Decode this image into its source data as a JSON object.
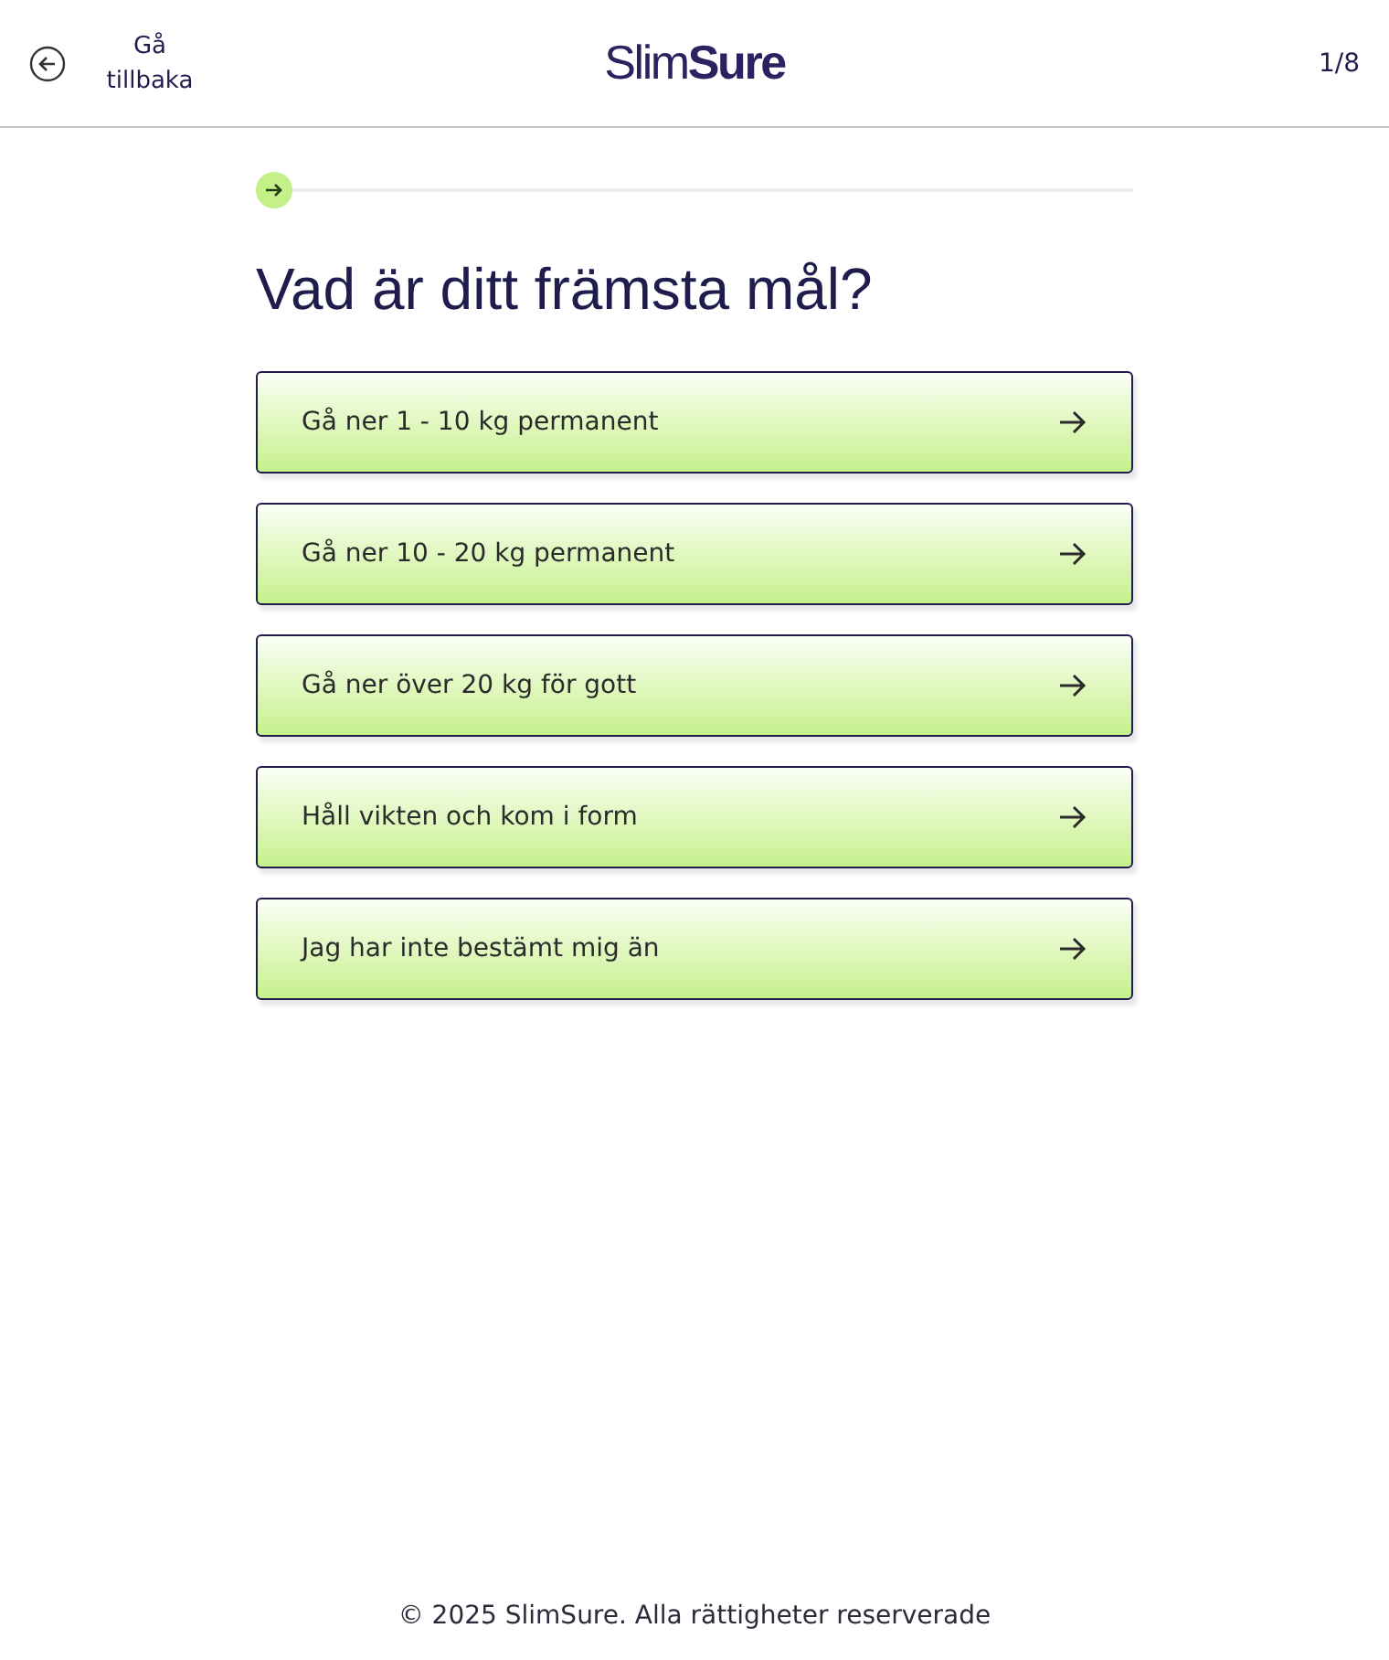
{
  "header": {
    "back_label": "Gå tillbaka",
    "logo": "Slim**Sure**",
    "step": "1/8"
  },
  "question": "Vad är ditt främsta mål?",
  "options": [
    {
      "label": "Gå ner 1 - 10 kg permanent"
    },
    {
      "label": "Gå ner 10 - 20 kg permanent"
    },
    {
      "label": "Gå ner över 20 kg för gott"
    },
    {
      "label": "Håll vikten och kom i form"
    },
    {
      "label": "Jag har inte bestämt mig än"
    }
  ],
  "footer": "© 2025 SlimSure. Alla rättigheter reserverade"
}
